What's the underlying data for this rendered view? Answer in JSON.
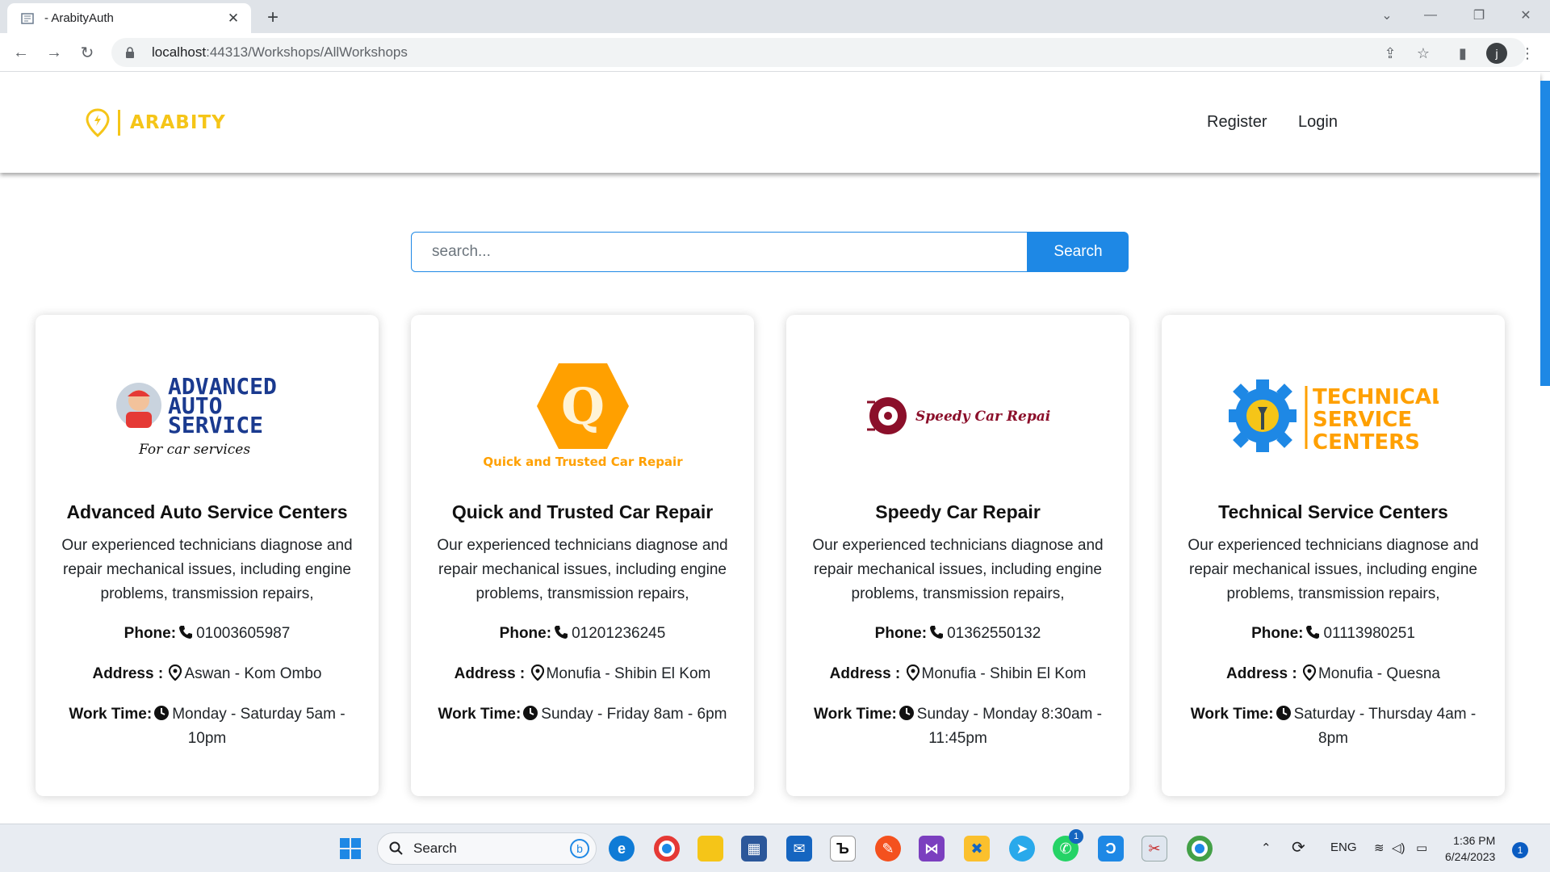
{
  "browser": {
    "tab_title": "- ArabityAuth",
    "tab_close": "✕",
    "new_tab": "+",
    "url_host": "localhost",
    "url_path": ":44313/Workshops/AllWorkshops",
    "profile_initial": "j"
  },
  "site": {
    "brand_name": "ARABITY",
    "brand_color": "#f5c518",
    "accent_color": "#1e88e5",
    "nav": {
      "register": "Register",
      "login": "Login"
    },
    "search": {
      "placeholder": "search...",
      "button": "Search"
    }
  },
  "workshops": [
    {
      "logo": {
        "line1": "ADVANCED",
        "line2": "AUTO",
        "line3": "SERVICE",
        "tagline": "For car services"
      },
      "name": "Advanced Auto Service Centers",
      "description": "Our experienced technicians diagnose and repair mechanical issues, including engine problems, transmission repairs,",
      "phone_label": "Phone:",
      "phone": "01003605987",
      "address_label": "Address :",
      "address": "Aswan - Kom Ombo",
      "worktime_label": "Work Time:",
      "worktime": "Monday - Saturday 5am - 10pm"
    },
    {
      "logo": {
        "letter": "Q",
        "caption": "Quick and Trusted Car Repair"
      },
      "name": "Quick and Trusted Car Repair",
      "description": "Our experienced technicians diagnose and repair mechanical issues, including engine problems, transmission repairs,",
      "phone_label": "Phone:",
      "phone": "01201236245",
      "address_label": "Address :",
      "address": "Monufia - Shibin El Kom",
      "worktime_label": "Work Time:",
      "worktime": "Sunday - Friday 8am - 6pm"
    },
    {
      "logo": {
        "caption": "Speedy Car Repair"
      },
      "name": "Speedy Car Repair",
      "description": "Our experienced technicians diagnose and repair mechanical issues, including engine problems, transmission repairs,",
      "phone_label": "Phone:",
      "phone": "01362550132",
      "address_label": "Address :",
      "address": "Monufia - Shibin El Kom",
      "worktime_label": "Work Time:",
      "worktime": "Sunday - Monday 8:30am - 11:45pm"
    },
    {
      "logo": {
        "line1": "TECHNICAL",
        "line2": "SERVICE",
        "line3": "CENTERS"
      },
      "name": "Technical Service Centers",
      "description": "Our experienced technicians diagnose and repair mechanical issues, including engine problems, transmission repairs,",
      "phone_label": "Phone:",
      "phone": "01113980251",
      "address_label": "Address :",
      "address": "Monufia - Quesna",
      "worktime_label": "Work Time:",
      "worktime": "Saturday - Thursday 4am - 8pm"
    }
  ],
  "taskbar": {
    "search_label": "Search",
    "language": "ENG",
    "time": "1:36 PM",
    "date": "6/24/2023",
    "notification_count": "1",
    "whatsapp_badge": "1"
  }
}
